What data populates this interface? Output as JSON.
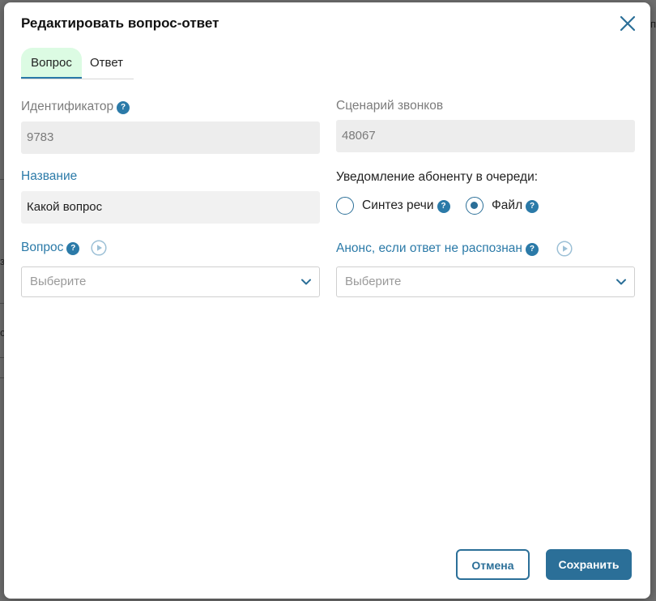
{
  "background": {
    "edge_glyphs": [
      "з",
      "с"
    ],
    "right_edge_glyph": "п"
  },
  "dialog": {
    "title": "Редактировать вопрос-ответ",
    "close_icon": "close-icon"
  },
  "tabs": [
    {
      "label": "Вопрос",
      "active": true
    },
    {
      "label": "Ответ",
      "active": false
    }
  ],
  "form": {
    "id": {
      "label": "Идентификатор",
      "value": "9783"
    },
    "scenario": {
      "label": "Сценарий звонков",
      "value": "48067"
    },
    "name": {
      "label": "Название",
      "value": "Какой вопрос"
    },
    "notification": {
      "label": "Уведомление абоненту в очереди:",
      "options": [
        {
          "label": "Синтез речи",
          "selected": false
        },
        {
          "label": "Файл",
          "selected": true
        }
      ]
    },
    "question": {
      "label": "Вопрос",
      "placeholder": "Выберите"
    },
    "announce": {
      "label": "Анонс, если ответ не распознан",
      "placeholder": "Выберите"
    }
  },
  "help_glyph": "?",
  "buttons": {
    "cancel": "Отмена",
    "save": "Сохранить"
  },
  "colors": {
    "accent": "#2b6f98",
    "label_blue": "#2b7aa8",
    "tab_active_bg": "#dcfbe3"
  }
}
